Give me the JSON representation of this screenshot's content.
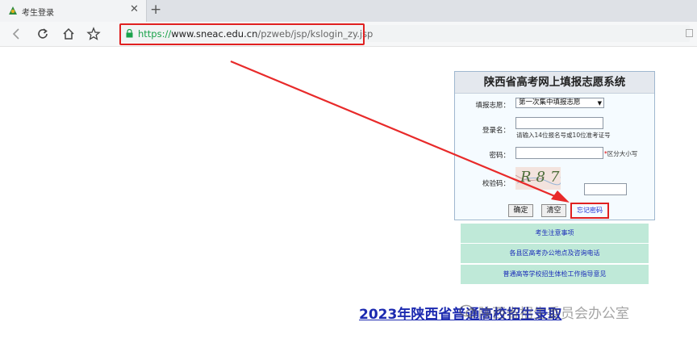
{
  "browser": {
    "tab_title": "考生登录",
    "url_protocol": "https://",
    "url_host": "www.sneac.edu.cn",
    "url_path": "/pzweb/jsp/kslogin_zy.jsp",
    "icons": [
      "back-icon",
      "reload-icon",
      "home-icon",
      "star-icon",
      "lock-icon",
      "close-icon",
      "new-tab-icon"
    ]
  },
  "login": {
    "title": "陕西省高考网上填报志愿系统",
    "volunteer_label": "填报志愿：",
    "volunteer_value": "第一次集中填报志愿",
    "username_label": "登录名：",
    "username_value": "",
    "username_hint": "请输入14位报名号或10位准考证号",
    "password_label": "密码：",
    "password_value": "",
    "password_hint_star": "*",
    "password_hint": "区分大小写",
    "captcha_label": "校验码：",
    "captcha_text": "R87",
    "captcha_value": "",
    "confirm_label": "确定",
    "clear_label": "清空",
    "forgot_label": "忘记密码"
  },
  "links": [
    "考生注意事项",
    "各县区高考办公地点及咨询电话",
    "普通高等学校招生体检工作指导意见"
  ],
  "footer": {
    "link_text": "2023年陕西省普通高校招生录取",
    "watermark": "陕西省招生委员会办公室"
  },
  "colors": {
    "highlight_red": "#e02020",
    "link_blue": "#1c2ab0",
    "link_bar_bg": "#bfe9d8",
    "secure_green": "#19a24a"
  }
}
